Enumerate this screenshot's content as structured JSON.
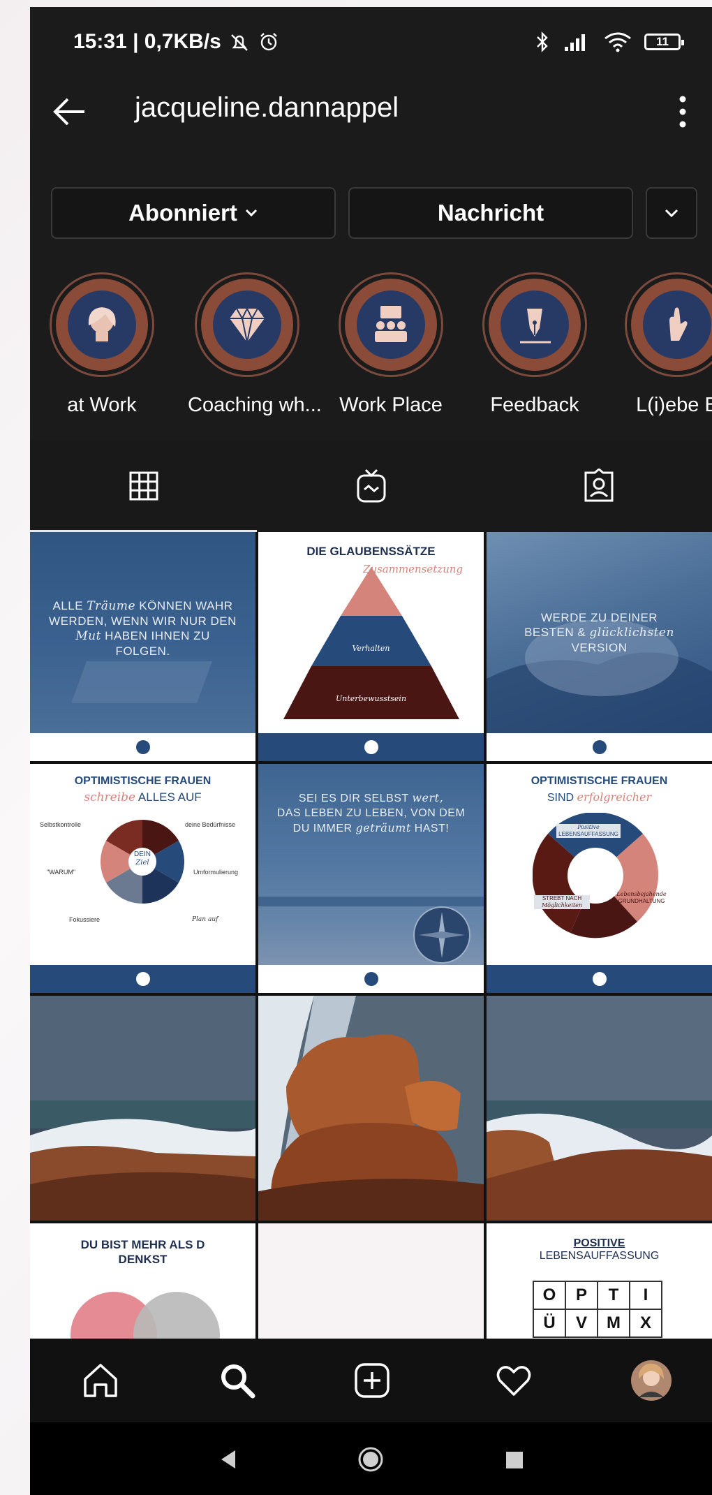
{
  "status_bar": {
    "time_speed": "15:31 | 0,7KB/s",
    "battery": "11"
  },
  "profile": {
    "username": "jacqueline.dannappel"
  },
  "actions": {
    "follow_label": "Abonniert",
    "message_label": "Nachricht"
  },
  "highlights": [
    {
      "label": "at Work",
      "icon": "woman-icon"
    },
    {
      "label": "Coaching wh...",
      "icon": "diamond-icon"
    },
    {
      "label": "Work Place",
      "icon": "people-icon"
    },
    {
      "label": "Feedback",
      "icon": "pen-icon"
    },
    {
      "label": "L(i)ebe B",
      "icon": "hand-icon"
    }
  ],
  "tabs": [
    {
      "name": "posts-grid",
      "icon": "grid-icon"
    },
    {
      "name": "igtv",
      "icon": "igtv-icon"
    },
    {
      "name": "tagged",
      "icon": "tagged-icon"
    }
  ],
  "posts": {
    "p1": {
      "line1": "ALLE",
      "w1": "Träume",
      "line1b": "KÖNNEN WAHR",
      "line2": "WERDEN, WENN WIR NUR DEN",
      "w2": "Mut",
      "line3": "HABEN IHNEN ZU",
      "line4": "FOLGEN."
    },
    "p2": {
      "title": "DIE GLAUBENSSÄTZE",
      "subtitle": "Zusammensetzung",
      "level1": "Verhalten",
      "level2": "Unterbewusstsein"
    },
    "p3": {
      "line1": "WERDE ZU DEINER",
      "line2a": "BESTEN &",
      "w1": "glücklichsten",
      "line3": "VERSION"
    },
    "p4": {
      "title": "OPTIMISTISCHE FRAUEN",
      "script": "schreibe",
      "title2": "ALLES AUF",
      "center": "DEIN",
      "center2": "Ziel",
      "label_tl": "Selbstkontrolle",
      "label_tr": "deine Bedürfnisse",
      "label_ml": "\"WARUM\"",
      "label_mr": "Umformulierung",
      "label_bl": "Fokussiere",
      "label_br": "Plan auf"
    },
    "p5": {
      "line1a": "SEI ES DIR SELBST",
      "w1": "wert,",
      "line2": "DAS LEBEN ZU LEBEN, VON DEM",
      "line3a": "DU IMMER",
      "w2": "geträumt",
      "line3b": "HAST!"
    },
    "p6": {
      "title": "OPTIMISTISCHE FRAUEN",
      "title2a": "SIND",
      "script": "erfolgreicher",
      "seg1": "Positive",
      "seg1b": "LEBENSAUFFASSUNG",
      "seg2": "STREBT NACH",
      "seg2b": "Möglichkeiten",
      "seg3": "Lebensbejahende",
      "seg3b": "GRUNDHALTUNG"
    },
    "p10": {
      "title": "DU BIST MEHR ALS D",
      "title2": "DENKST"
    },
    "p12": {
      "title": "POSITIVE",
      "title2": "LEBENSAUFFASSUNG",
      "row1": [
        "O",
        "P",
        "T",
        "I"
      ],
      "row2": [
        "Ü",
        "V",
        "M",
        "X"
      ]
    }
  },
  "colors": {
    "navy": "#264b7a",
    "rust": "#8a4b38",
    "background": "#1b1b1b"
  }
}
